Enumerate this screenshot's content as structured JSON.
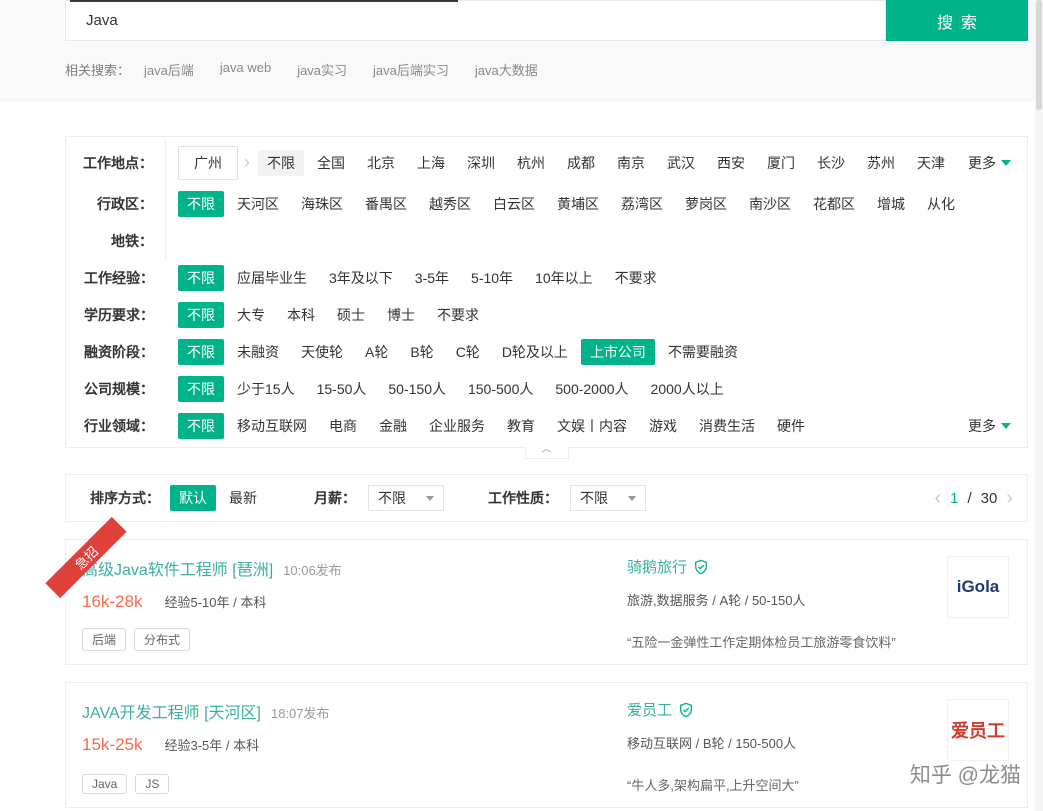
{
  "colors": {
    "accent": "#00b38a",
    "link": "#3ab0a2",
    "salary": "#fa6a47",
    "ribbon": "#e0403a"
  },
  "icons": {
    "chevron_left": "‹",
    "chevron_right": "›",
    "city_arrow": "›",
    "collapse_caret": "︿"
  },
  "search": {
    "query": "Java",
    "button_label": "搜索",
    "related_label": "相关搜索：",
    "related": [
      "java后端",
      "java web",
      "java实习",
      "java后端实习",
      "java大数据"
    ]
  },
  "filters": {
    "rows": [
      {
        "label": "工作地点：",
        "current": "广州",
        "more": "更多",
        "items": [
          {
            "t": "不限",
            "sel": "tab"
          },
          {
            "t": "全国"
          },
          {
            "t": "北京"
          },
          {
            "t": "上海"
          },
          {
            "t": "深圳"
          },
          {
            "t": "杭州"
          },
          {
            "t": "成都"
          },
          {
            "t": "南京"
          },
          {
            "t": "武汉"
          },
          {
            "t": "西安"
          },
          {
            "t": "厦门"
          },
          {
            "t": "长沙"
          },
          {
            "t": "苏州"
          },
          {
            "t": "天津"
          }
        ]
      },
      {
        "label": "行政区：",
        "items": [
          {
            "t": "不限",
            "sel": "chip"
          },
          {
            "t": "天河区"
          },
          {
            "t": "海珠区"
          },
          {
            "t": "番禺区"
          },
          {
            "t": "越秀区"
          },
          {
            "t": "白云区"
          },
          {
            "t": "黄埔区"
          },
          {
            "t": "荔湾区"
          },
          {
            "t": "萝岗区"
          },
          {
            "t": "南沙区"
          },
          {
            "t": "花都区"
          },
          {
            "t": "增城"
          },
          {
            "t": "从化"
          }
        ]
      },
      {
        "label": "地铁：",
        "items": []
      },
      {
        "label": "工作经验：",
        "items": [
          {
            "t": "不限",
            "sel": "chip"
          },
          {
            "t": "应届毕业生"
          },
          {
            "t": "3年及以下"
          },
          {
            "t": "3-5年"
          },
          {
            "t": "5-10年"
          },
          {
            "t": "10年以上"
          },
          {
            "t": "不要求"
          }
        ]
      },
      {
        "label": "学历要求：",
        "items": [
          {
            "t": "不限",
            "sel": "chip"
          },
          {
            "t": "大专"
          },
          {
            "t": "本科"
          },
          {
            "t": "硕士"
          },
          {
            "t": "博士"
          },
          {
            "t": "不要求"
          }
        ]
      },
      {
        "label": "融资阶段：",
        "items": [
          {
            "t": "不限",
            "sel": "chip"
          },
          {
            "t": "未融资"
          },
          {
            "t": "天使轮"
          },
          {
            "t": "A轮"
          },
          {
            "t": "B轮"
          },
          {
            "t": "C轮"
          },
          {
            "t": "D轮及以上"
          },
          {
            "t": "上市公司",
            "sel": "chip"
          },
          {
            "t": "不需要融资"
          }
        ]
      },
      {
        "label": "公司规模：",
        "items": [
          {
            "t": "不限",
            "sel": "chip"
          },
          {
            "t": "少于15人"
          },
          {
            "t": "15-50人"
          },
          {
            "t": "50-150人"
          },
          {
            "t": "150-500人"
          },
          {
            "t": "500-2000人"
          },
          {
            "t": "2000人以上"
          }
        ]
      },
      {
        "label": "行业领域：",
        "more": "更多",
        "items": [
          {
            "t": "不限",
            "sel": "chip"
          },
          {
            "t": "移动互联网"
          },
          {
            "t": "电商"
          },
          {
            "t": "金融"
          },
          {
            "t": "企业服务"
          },
          {
            "t": "教育"
          },
          {
            "t": "文娱丨内容"
          },
          {
            "t": "游戏"
          },
          {
            "t": "消费生活"
          },
          {
            "t": "硬件"
          }
        ]
      }
    ]
  },
  "sort": {
    "label": "排序方式：",
    "options": [
      {
        "t": "默认",
        "sel": true
      },
      {
        "t": "最新"
      }
    ],
    "salary_label": "月薪：",
    "salary_value": "不限",
    "nature_label": "工作性质：",
    "nature_value": "不限",
    "pagination": {
      "current": "1",
      "separator": "/",
      "total": "30"
    }
  },
  "jobs": [
    {
      "urgent_badge": "急招",
      "title": "高级Java软件工程师 [琶洲]",
      "time": "10:06发布",
      "salary": "16k-28k",
      "requirements": "经验5-10年 / 本科",
      "tags": [
        "后端",
        "分布式"
      ],
      "company": "骑鹅旅行",
      "company_info": "旅游,数据服务 / A轮 / 50-150人",
      "quote": "“五险一金弹性工作定期体检员工旅游零食饮料”",
      "logo_text": "iGola",
      "logo_color": "#233a70",
      "logo_class": "logo-latin"
    },
    {
      "urgent_badge": null,
      "title": "JAVA开发工程师 [天河区]",
      "time": "18:07发布",
      "salary": "15k-25k",
      "requirements": "经验3-5年 / 本科",
      "tags": [
        "Java",
        "JS"
      ],
      "company": "爱员工",
      "company_info": "移动互联网 / B轮 / 150-500人",
      "quote": "“牛人多,架构扁平,上升空间大”",
      "logo_text": "爱员工",
      "logo_color": "#cf3b30",
      "logo_class": "logo-cjk"
    }
  ],
  "watermark": "知乎 @龙猫"
}
